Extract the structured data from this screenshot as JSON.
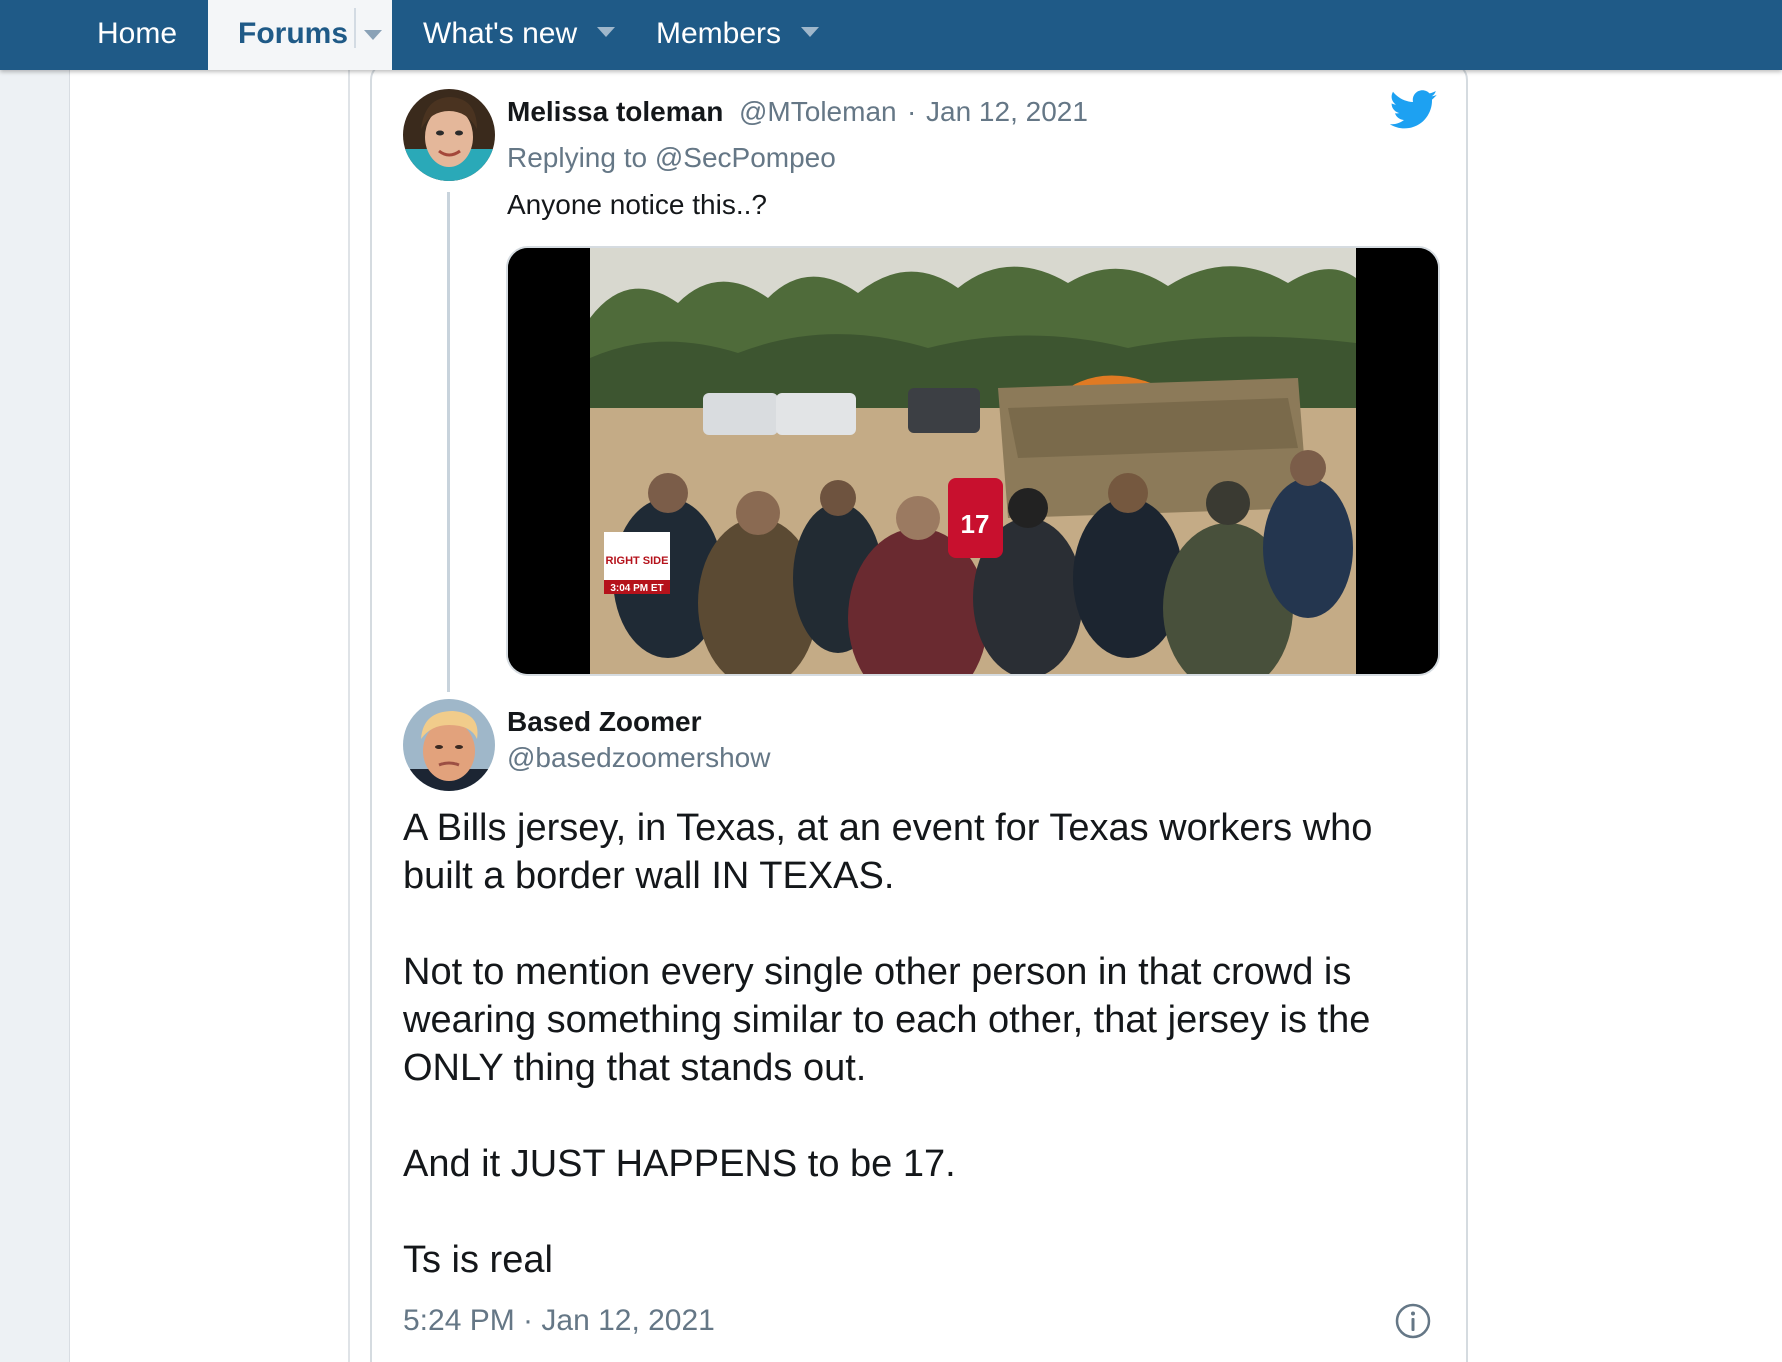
{
  "nav": {
    "home": "Home",
    "forums": "Forums",
    "whats_new": "What's new",
    "members": "Members"
  },
  "tweet_reply": {
    "name": "Melissa toleman",
    "handle": "@MToleman",
    "separator": "·",
    "date": "Jan 12, 2021",
    "replying_to": "Replying to @SecPompeo",
    "text": "Anyone notice this..?",
    "media_overlay": {
      "logo_text": "RIGHT SIDE",
      "time_text": "3:04 PM ET",
      "jersey_number": "17"
    }
  },
  "tweet_main": {
    "name": "Based Zoomer",
    "handle": "@basedzoomershow",
    "paragraphs": [
      "A Bills jersey, in Texas, at an event for Texas workers who built a border wall IN TEXAS.",
      "Not to mention every single other person in that crowd is wearing something similar to each other, that jersey is the ONLY thing that stands out.",
      "And it JUST HAPPENS to be 17.",
      "Ts is real"
    ],
    "timestamp": "5:24 PM · Jan 12, 2021"
  },
  "icons": {
    "brand": "twitter-bird-icon",
    "info": "info-icon",
    "dropdown": "chevron-down-icon"
  },
  "colors": {
    "nav_bg": "#1f5a87",
    "twitter_blue": "#1da1f2",
    "muted_text": "#657786"
  }
}
